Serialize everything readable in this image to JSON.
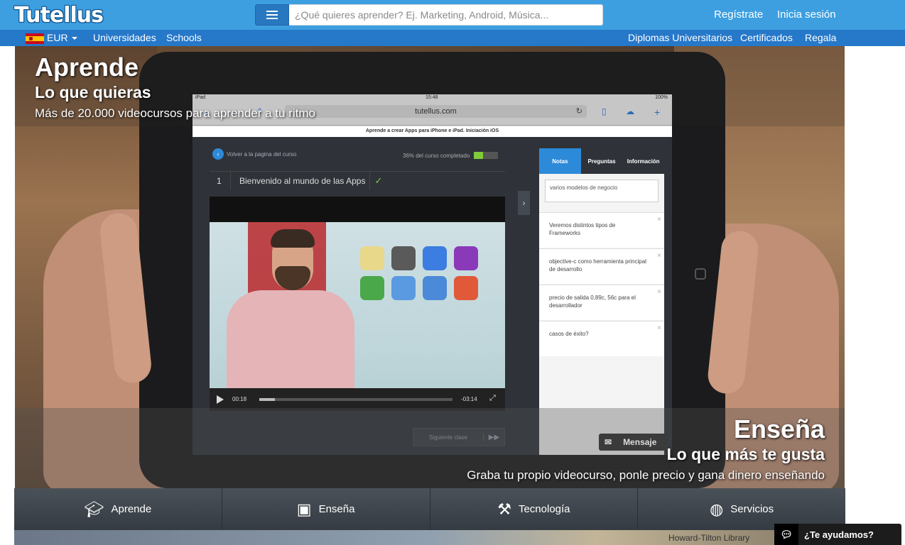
{
  "header": {
    "logo": "Tutellus",
    "search_placeholder": "¿Qué quieres aprender? Ej. Marketing, Android, Música...",
    "register": "Regístrate",
    "login": "Inicia sesión"
  },
  "subnav": {
    "currency": "EUR",
    "left_links": [
      "Universidades",
      "Schools"
    ],
    "right_links": [
      "Diplomas Universitarios",
      "Certificados",
      "Regala"
    ]
  },
  "hero": {
    "left_title": "Aprende",
    "left_subtitle": "Lo que quieras",
    "left_text": "Más de 20.000 videocursos para aprender a tu ritmo",
    "right_title": "Enseña",
    "right_subtitle": "Lo que más te gusta",
    "right_text": "Graba tu propio videocurso, ponle precio y gana dinero enseñando"
  },
  "tablet": {
    "status_left": "iPad",
    "status_time": "15:48",
    "status_battery": "100%",
    "url": "tutellus.com",
    "page_title": "Aprende a crear Apps para iPhone e iPad. Iniciación iOS",
    "back_label": "Volver a la pagina del curso",
    "progress_text": "36% del curso completado",
    "progress": 0.36,
    "lesson_number": "1",
    "lesson_title": "Bienvenido al mundo de las Apps",
    "time_current": "00:18",
    "time_remaining": "-03:14",
    "next_class": "Siguiente clase",
    "tabs": [
      "Notas",
      "Preguntas",
      "Información"
    ],
    "note_input": "varios modelos de negocio",
    "notes": [
      "Veremos distintos tipos de Frameworks",
      "objective-c como herramienta principal de desarrollo",
      "precio de salida 0,89c, 56c para el desarrollador",
      "casos de éxito?"
    ]
  },
  "message_button": "Mensaje",
  "bottom_nav": [
    {
      "label": "Aprende",
      "icon": "graduation-cap-icon"
    },
    {
      "label": "Enseña",
      "icon": "film-icon"
    },
    {
      "label": "Tecnología",
      "icon": "tools-icon"
    },
    {
      "label": "Servicios",
      "icon": "globe-icon"
    }
  ],
  "below_text": "Howard-Tilton Library",
  "help_widget": "¿Te ayudamos?",
  "colors": {
    "header_blue": "#3d9fe0",
    "subnav_blue": "#2678c9",
    "accent_green": "#7fcb3a"
  }
}
